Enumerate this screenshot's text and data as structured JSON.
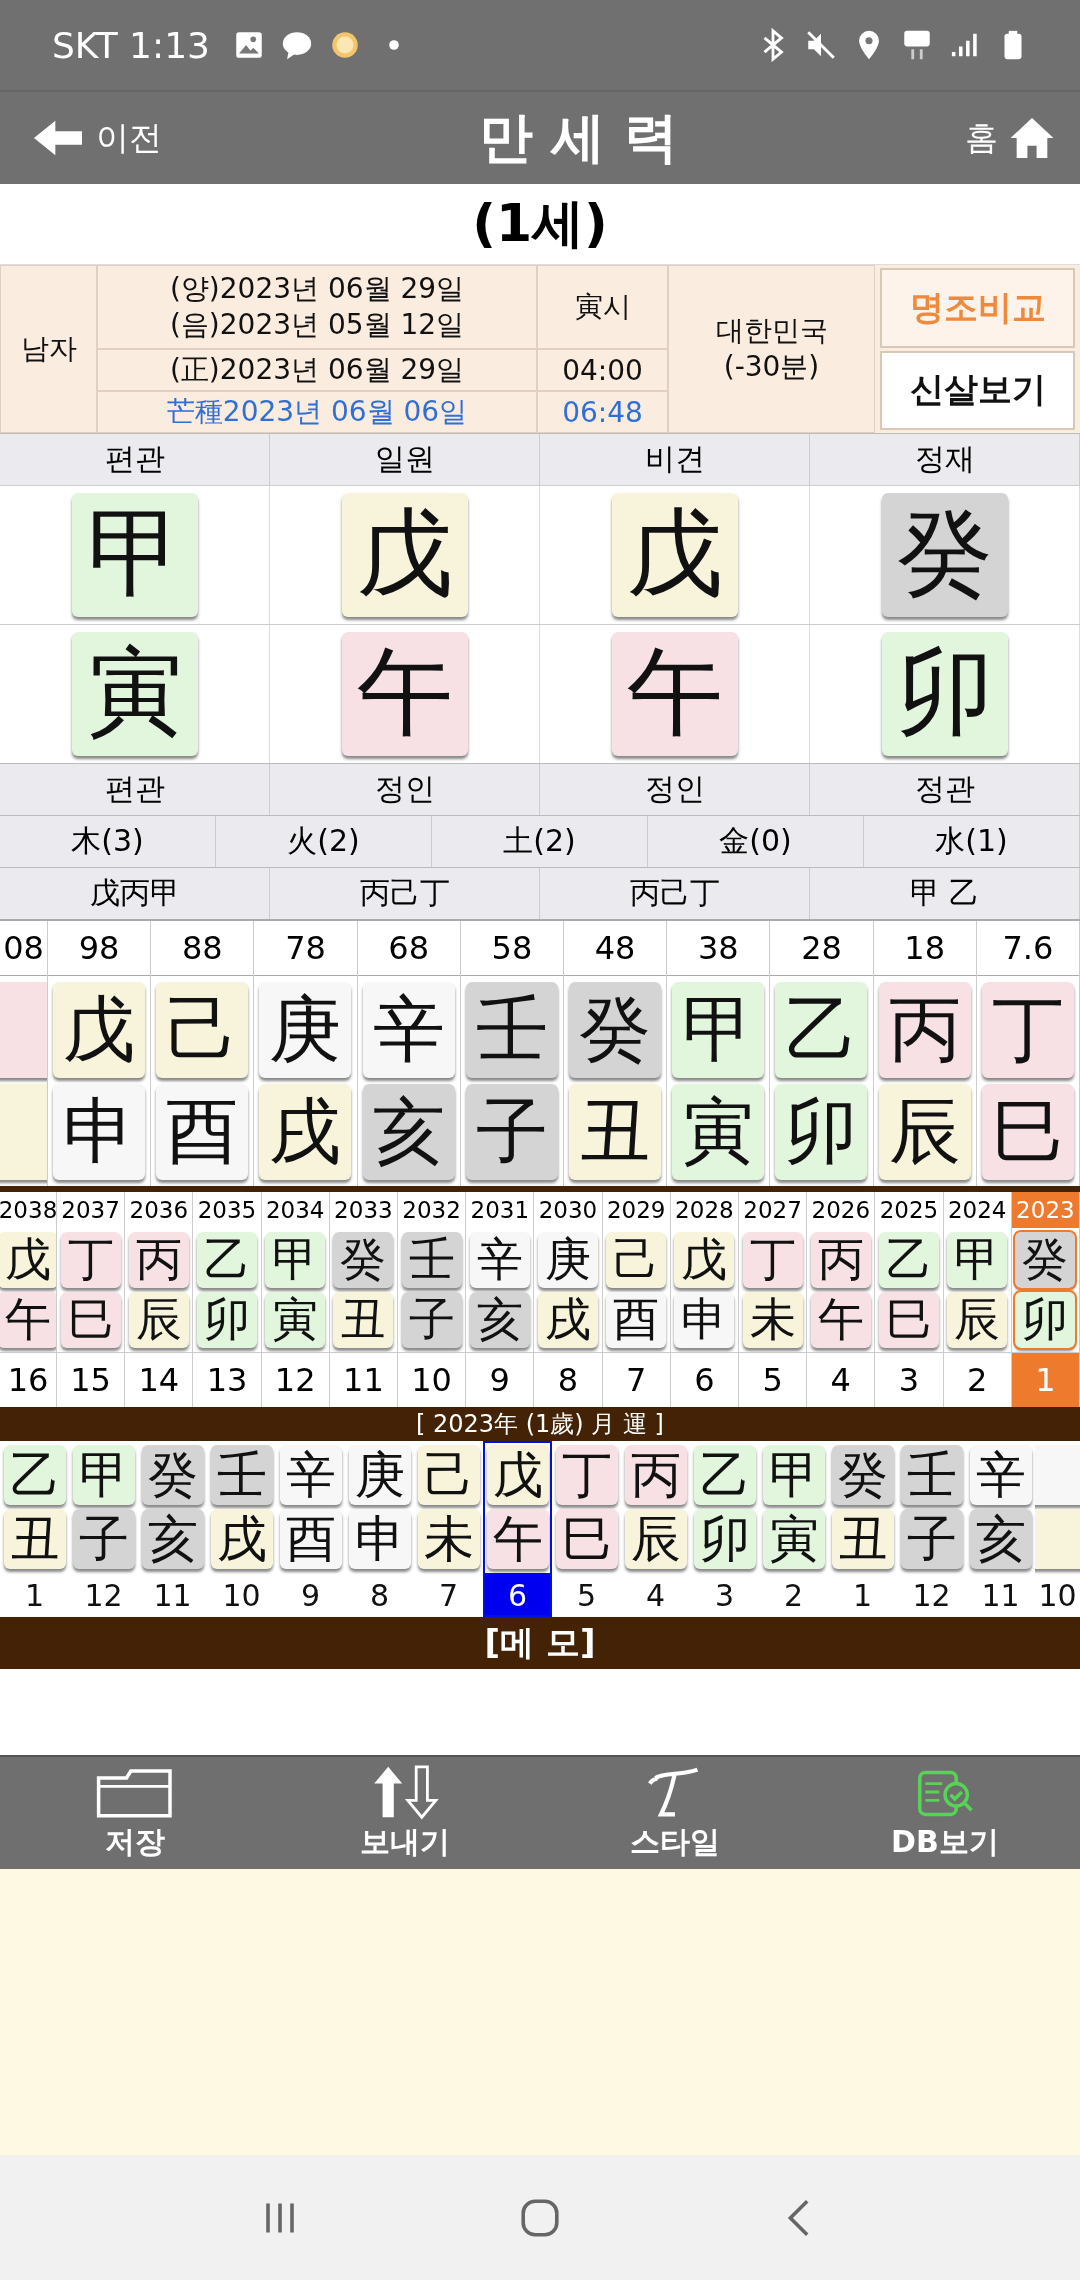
{
  "status_bar": {
    "carrier_time": "SKT 1:13"
  },
  "header": {
    "back": "이전",
    "title": "만 세 력",
    "home": "홈"
  },
  "age": "(1세)",
  "info": {
    "gender": "남자",
    "solar": "(양)2023년 06월 29일",
    "lunar": "(음)2023년 05월 12일",
    "hour_branch": "寅시",
    "corrected": "(正)2023년 06월 29일",
    "time": "04:00",
    "solar_term": "芒種2023년 06월 06일",
    "term_time": "06:48",
    "region": "대한민국",
    "offset": "(-30분)",
    "buttons": [
      {
        "label": "명조비교",
        "kind": "accent"
      },
      {
        "label": "신살보기",
        "kind": "plain"
      }
    ]
  },
  "pillars": [
    {
      "top": "편관",
      "stem": {
        "char": "甲",
        "color": "#e2f5dd"
      },
      "branch": {
        "char": "寅",
        "color": "#e2f5dd"
      },
      "bottom": "편관",
      "hidden": "戊丙甲"
    },
    {
      "top": "일원",
      "stem": {
        "char": "戊",
        "color": "#f8f4dc"
      },
      "branch": {
        "char": "午",
        "color": "#f7e1e4"
      },
      "bottom": "정인",
      "hidden": "丙己丁"
    },
    {
      "top": "비견",
      "stem": {
        "char": "戊",
        "color": "#f8f4dc"
      },
      "branch": {
        "char": "午",
        "color": "#f7e1e4"
      },
      "bottom": "정인",
      "hidden": "丙己丁"
    },
    {
      "top": "정재",
      "stem": {
        "char": "癸",
        "color": "#d4d4d4"
      },
      "branch": {
        "char": "卯",
        "color": "#e2f5dd"
      },
      "bottom": "정관",
      "hidden": "甲 乙"
    }
  ],
  "elements": [
    "木(3)",
    "火(2)",
    "土(2)",
    "金(0)",
    "水(1)"
  ],
  "daeun": [
    {
      "age": "08",
      "stem": {
        "color": "#f7e1e4"
      },
      "branch": {
        "color": "#f8f4dc"
      }
    },
    {
      "age": "98",
      "stem": {
        "char": "戊",
        "color": "#f8f4dc"
      },
      "branch": {
        "char": "申",
        "color": "#f7f7f7"
      }
    },
    {
      "age": "88",
      "stem": {
        "char": "己",
        "color": "#f8f4dc"
      },
      "branch": {
        "char": "酉",
        "color": "#f7f7f7"
      }
    },
    {
      "age": "78",
      "stem": {
        "char": "庚",
        "color": "#f7f7f7"
      },
      "branch": {
        "char": "戌",
        "color": "#f8f4dc"
      }
    },
    {
      "age": "68",
      "stem": {
        "char": "辛",
        "color": "#f7f7f7"
      },
      "branch": {
        "char": "亥",
        "color": "#d4d4d4"
      }
    },
    {
      "age": "58",
      "stem": {
        "char": "壬",
        "color": "#d4d4d4"
      },
      "branch": {
        "char": "子",
        "color": "#d4d4d4"
      }
    },
    {
      "age": "48",
      "stem": {
        "char": "癸",
        "color": "#d4d4d4"
      },
      "branch": {
        "char": "丑",
        "color": "#f8f4dc"
      }
    },
    {
      "age": "38",
      "stem": {
        "char": "甲",
        "color": "#e2f5dd"
      },
      "branch": {
        "char": "寅",
        "color": "#e2f5dd"
      }
    },
    {
      "age": "28",
      "stem": {
        "char": "乙",
        "color": "#e2f5dd"
      },
      "branch": {
        "char": "卯",
        "color": "#e2f5dd"
      }
    },
    {
      "age": "18",
      "stem": {
        "char": "丙",
        "color": "#f7e1e4"
      },
      "branch": {
        "char": "辰",
        "color": "#f8f4dc"
      }
    },
    {
      "age": "7.6",
      "stem": {
        "char": "丁",
        "color": "#f7e1e4"
      },
      "branch": {
        "char": "巳",
        "color": "#f7e1e4"
      }
    }
  ],
  "years": [
    {
      "year": "2038",
      "age": "16",
      "selected": false,
      "stem": {
        "char": "戊",
        "color": "#f8f4dc"
      },
      "branch": {
        "char": "午",
        "color": "#f7e1e4"
      }
    },
    {
      "year": "2037",
      "age": "15",
      "selected": false,
      "stem": {
        "char": "丁",
        "color": "#f7e1e4"
      },
      "branch": {
        "char": "巳",
        "color": "#f7e1e4"
      }
    },
    {
      "year": "2036",
      "age": "14",
      "selected": false,
      "stem": {
        "char": "丙",
        "color": "#f7e1e4"
      },
      "branch": {
        "char": "辰",
        "color": "#f8f4dc"
      }
    },
    {
      "year": "2035",
      "age": "13",
      "selected": false,
      "stem": {
        "char": "乙",
        "color": "#e2f5dd"
      },
      "branch": {
        "char": "卯",
        "color": "#e2f5dd"
      }
    },
    {
      "year": "2034",
      "age": "12",
      "selected": false,
      "stem": {
        "char": "甲",
        "color": "#e2f5dd"
      },
      "branch": {
        "char": "寅",
        "color": "#e2f5dd"
      }
    },
    {
      "year": "2033",
      "age": "11",
      "selected": false,
      "stem": {
        "char": "癸",
        "color": "#d4d4d4"
      },
      "branch": {
        "char": "丑",
        "color": "#f8f4dc"
      }
    },
    {
      "year": "2032",
      "age": "10",
      "selected": false,
      "stem": {
        "char": "壬",
        "color": "#d4d4d4"
      },
      "branch": {
        "char": "子",
        "color": "#d4d4d4"
      }
    },
    {
      "year": "2031",
      "age": "9",
      "selected": false,
      "stem": {
        "char": "辛",
        "color": "#f7f7f7"
      },
      "branch": {
        "char": "亥",
        "color": "#d4d4d4"
      }
    },
    {
      "year": "2030",
      "age": "8",
      "selected": false,
      "stem": {
        "char": "庚",
        "color": "#f7f7f7"
      },
      "branch": {
        "char": "戌",
        "color": "#f8f4dc"
      }
    },
    {
      "year": "2029",
      "age": "7",
      "selected": false,
      "stem": {
        "char": "己",
        "color": "#f8f4dc"
      },
      "branch": {
        "char": "酉",
        "color": "#f7f7f7"
      }
    },
    {
      "year": "2028",
      "age": "6",
      "selected": false,
      "stem": {
        "char": "戊",
        "color": "#f8f4dc"
      },
      "branch": {
        "char": "申",
        "color": "#f7f7f7"
      }
    },
    {
      "year": "2027",
      "age": "5",
      "selected": false,
      "stem": {
        "char": "丁",
        "color": "#f7e1e4"
      },
      "branch": {
        "char": "未",
        "color": "#f8f4dc"
      }
    },
    {
      "year": "2026",
      "age": "4",
      "selected": false,
      "stem": {
        "char": "丙",
        "color": "#f7e1e4"
      },
      "branch": {
        "char": "午",
        "color": "#f7e1e4"
      }
    },
    {
      "year": "2025",
      "age": "3",
      "selected": false,
      "stem": {
        "char": "乙",
        "color": "#e2f5dd"
      },
      "branch": {
        "char": "巳",
        "color": "#f7e1e4"
      }
    },
    {
      "year": "2024",
      "age": "2",
      "selected": false,
      "stem": {
        "char": "甲",
        "color": "#e2f5dd"
      },
      "branch": {
        "char": "辰",
        "color": "#f8f4dc"
      }
    },
    {
      "year": "2023",
      "age": "1",
      "selected": true,
      "stem": {
        "char": "癸",
        "color": "#d4d4d4"
      },
      "branch": {
        "char": "卯",
        "color": "#e2f5dd"
      }
    }
  ],
  "months_header": "[ 2023年 (1歲) 月 運 ]",
  "months": [
    {
      "month": "1",
      "selected": false,
      "stem": {
        "char": "乙",
        "color": "#e2f5dd"
      },
      "branch": {
        "char": "丑",
        "color": "#f8f4dc"
      }
    },
    {
      "month": "12",
      "selected": false,
      "stem": {
        "char": "甲",
        "color": "#e2f5dd"
      },
      "branch": {
        "char": "子",
        "color": "#d4d4d4"
      }
    },
    {
      "month": "11",
      "selected": false,
      "stem": {
        "char": "癸",
        "color": "#d4d4d4"
      },
      "branch": {
        "char": "亥",
        "color": "#d4d4d4"
      }
    },
    {
      "month": "10",
      "selected": false,
      "stem": {
        "char": "壬",
        "color": "#d4d4d4"
      },
      "branch": {
        "char": "戌",
        "color": "#f8f4dc"
      }
    },
    {
      "month": "9",
      "selected": false,
      "stem": {
        "char": "辛",
        "color": "#f7f7f7"
      },
      "branch": {
        "char": "酉",
        "color": "#f7f7f7"
      }
    },
    {
      "month": "8",
      "selected": false,
      "stem": {
        "char": "庚",
        "color": "#f7f7f7"
      },
      "branch": {
        "char": "申",
        "color": "#f7f7f7"
      }
    },
    {
      "month": "7",
      "selected": false,
      "stem": {
        "char": "己",
        "color": "#f8f4dc"
      },
      "branch": {
        "char": "未",
        "color": "#f8f4dc"
      }
    },
    {
      "month": "6",
      "selected": true,
      "stem": {
        "char": "戊",
        "color": "#f8f4dc"
      },
      "branch": {
        "char": "午",
        "color": "#f7e1e4"
      }
    },
    {
      "month": "5",
      "selected": false,
      "stem": {
        "char": "丁",
        "color": "#f7e1e4"
      },
      "branch": {
        "char": "巳",
        "color": "#f7e1e4"
      }
    },
    {
      "month": "4",
      "selected": false,
      "stem": {
        "char": "丙",
        "color": "#f7e1e4"
      },
      "branch": {
        "char": "辰",
        "color": "#f8f4dc"
      }
    },
    {
      "month": "3",
      "selected": false,
      "stem": {
        "char": "乙",
        "color": "#e2f5dd"
      },
      "branch": {
        "char": "卯",
        "color": "#e2f5dd"
      }
    },
    {
      "month": "2",
      "selected": false,
      "stem": {
        "char": "甲",
        "color": "#e2f5dd"
      },
      "branch": {
        "char": "寅",
        "color": "#e2f5dd"
      }
    },
    {
      "month": "1",
      "selected": false,
      "stem": {
        "char": "癸",
        "color": "#d4d4d4"
      },
      "branch": {
        "char": "丑",
        "color": "#f8f4dc"
      }
    },
    {
      "month": "12",
      "selected": false,
      "stem": {
        "char": "壬",
        "color": "#d4d4d4"
      },
      "branch": {
        "char": "子",
        "color": "#d4d4d4"
      }
    },
    {
      "month": "11",
      "selected": false,
      "stem": {
        "char": "辛",
        "color": "#f7f7f7"
      },
      "branch": {
        "char": "亥",
        "color": "#d4d4d4"
      }
    },
    {
      "month": "10",
      "selected": false,
      "stem": {
        "color": "#f7f7f7"
      },
      "branch": {
        "color": "#f8f4dc"
      }
    }
  ],
  "memo_title": "[메  모]",
  "toolbar": [
    {
      "label": "저장",
      "kind": "save",
      "selected": false
    },
    {
      "label": "보내기",
      "kind": "send",
      "selected": false
    },
    {
      "label": "스타일",
      "kind": "style",
      "selected": false
    },
    {
      "label": "DB보기",
      "kind": "db",
      "selected": true
    }
  ]
}
